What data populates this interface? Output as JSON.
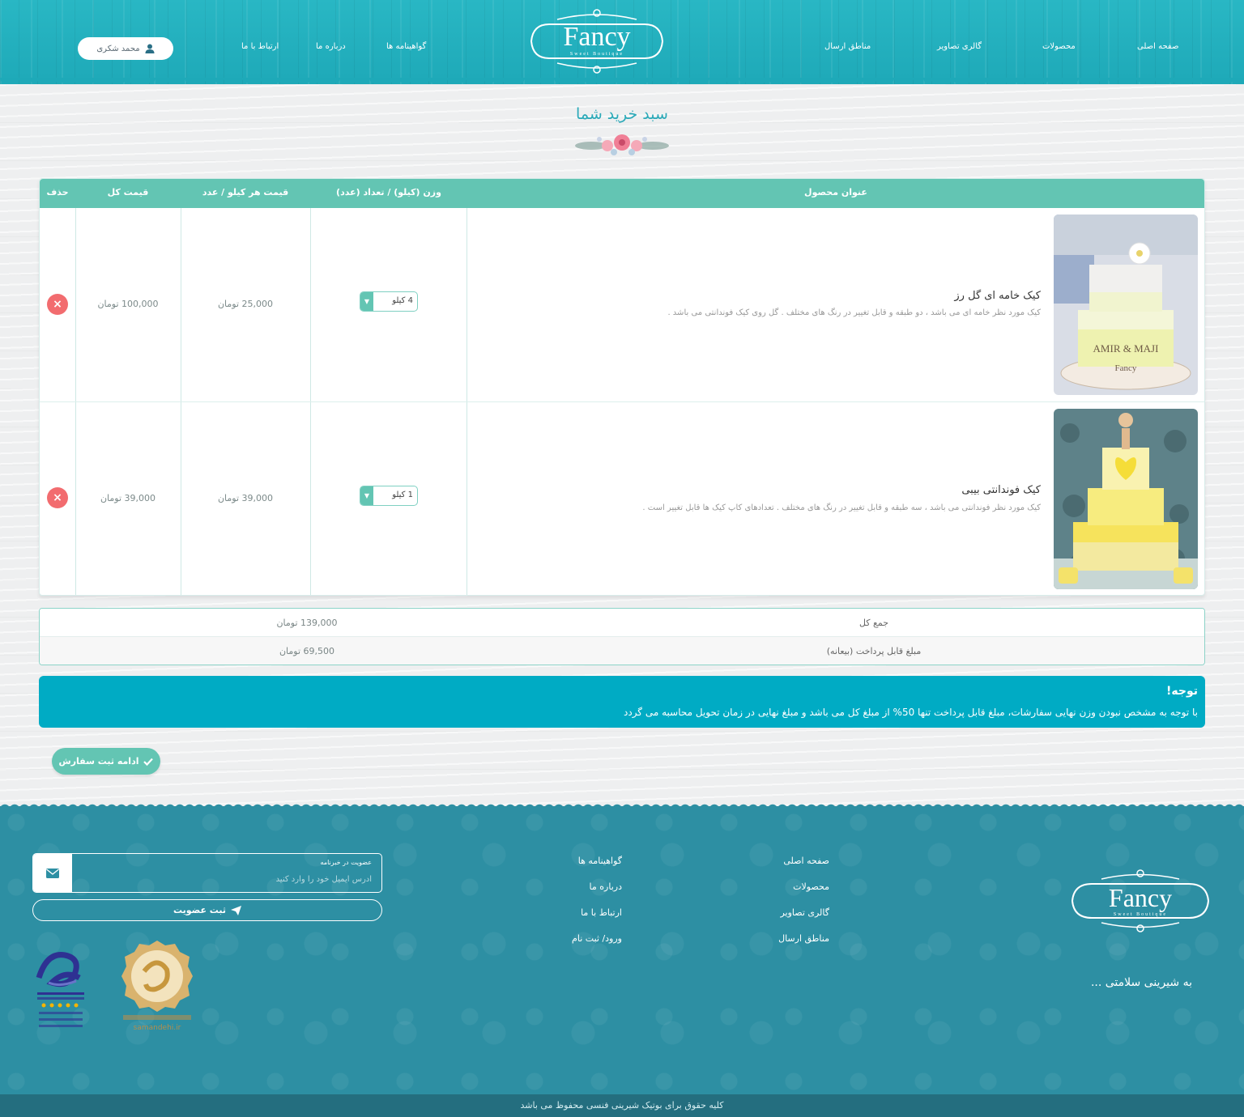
{
  "header": {
    "nav": {
      "home": "صفحه اصلی",
      "products": "محصولات",
      "gallery": "گالری تصاویر",
      "delivery": "مناطق ارسال",
      "certificates": "گواهینامه ها",
      "about": "درباره ما",
      "contact": "ارتباط با ما"
    },
    "logo_text": "Fancy",
    "logo_sub": "Sweet Boutique",
    "user_name": "محمد شکری"
  },
  "page": {
    "title": "سبد خرید شما"
  },
  "cart": {
    "columns": {
      "title": "عنوان محصول",
      "weight": "وزن (کیلو) / تعداد (عدد)",
      "unit_price": "قیمت هر کیلو / عدد",
      "total": "قیمت کل",
      "delete": "حذف"
    },
    "rows": [
      {
        "title": "کیک خامه ای گل رز",
        "desc": "کیک مورد نظر خامه ای می باشد ، دو طبقه و قابل تغییر در رنگ های مختلف . گل روی کیک فوندانتی می باشد .",
        "qty": "4 کیلو",
        "unit_price": "25,000 تومان",
        "total": "100,000 تومان",
        "cake_text": "AMIR & MAJI"
      },
      {
        "title": "کیک فوندانتی بیبی",
        "desc": "کیک مورد نظر فوندانتی می باشد ، سه طبقه و قابل تغییر در رنگ های مختلف . تعدادهای کاپ کیک ها قابل تغییر است .",
        "qty": "1 کیلو",
        "unit_price": "39,000 تومان",
        "total": "39,000 تومان"
      }
    ],
    "delete_symbol": "×"
  },
  "summary": {
    "total_label": "جمع کل",
    "total_value": "139,000 تومان",
    "payable_label": "مبلغ قابل پرداخت (بیعانه)",
    "payable_value": "69,500 تومان"
  },
  "notice": {
    "title": "توجه!",
    "text": "با توجه به مشخص نبودن وزن نهایی سفارشات، مبلغ قابل پرداخت تنها 50% از مبلغ کل می باشد و مبلغ نهایی در زمان تحویل محاسبه می گردد"
  },
  "continue_label": "ادامه ثبت سفارش",
  "footer": {
    "col1": [
      "صفحه اصلی",
      "محصولات",
      "گالری تصاویر",
      "مناطق ارسال"
    ],
    "col2": [
      "گواهینامه ها",
      "درباره ما",
      "ارتباط با ما",
      "ورود/ ثبت نام"
    ],
    "slogan": "به شیرینی سلامتی ...",
    "newsletter_label": "عضویت در خبرنامه",
    "newsletter_placeholder": "آدرس ایمیل خود را وارد کنید",
    "subscribe_label": "ثبت عضویت",
    "badge_samandehi": "samandehi.ir",
    "copyright": "کلیه حقوق برای بوتیک شیرینی فنسی محفوظ می باشد"
  },
  "colors": {
    "header_teal": "#1ea9b8",
    "accent_green": "#63c5b3",
    "notice_blue": "#00abc4",
    "footer_teal": "#2d8fa3",
    "delete_red": "#f26c6f"
  }
}
